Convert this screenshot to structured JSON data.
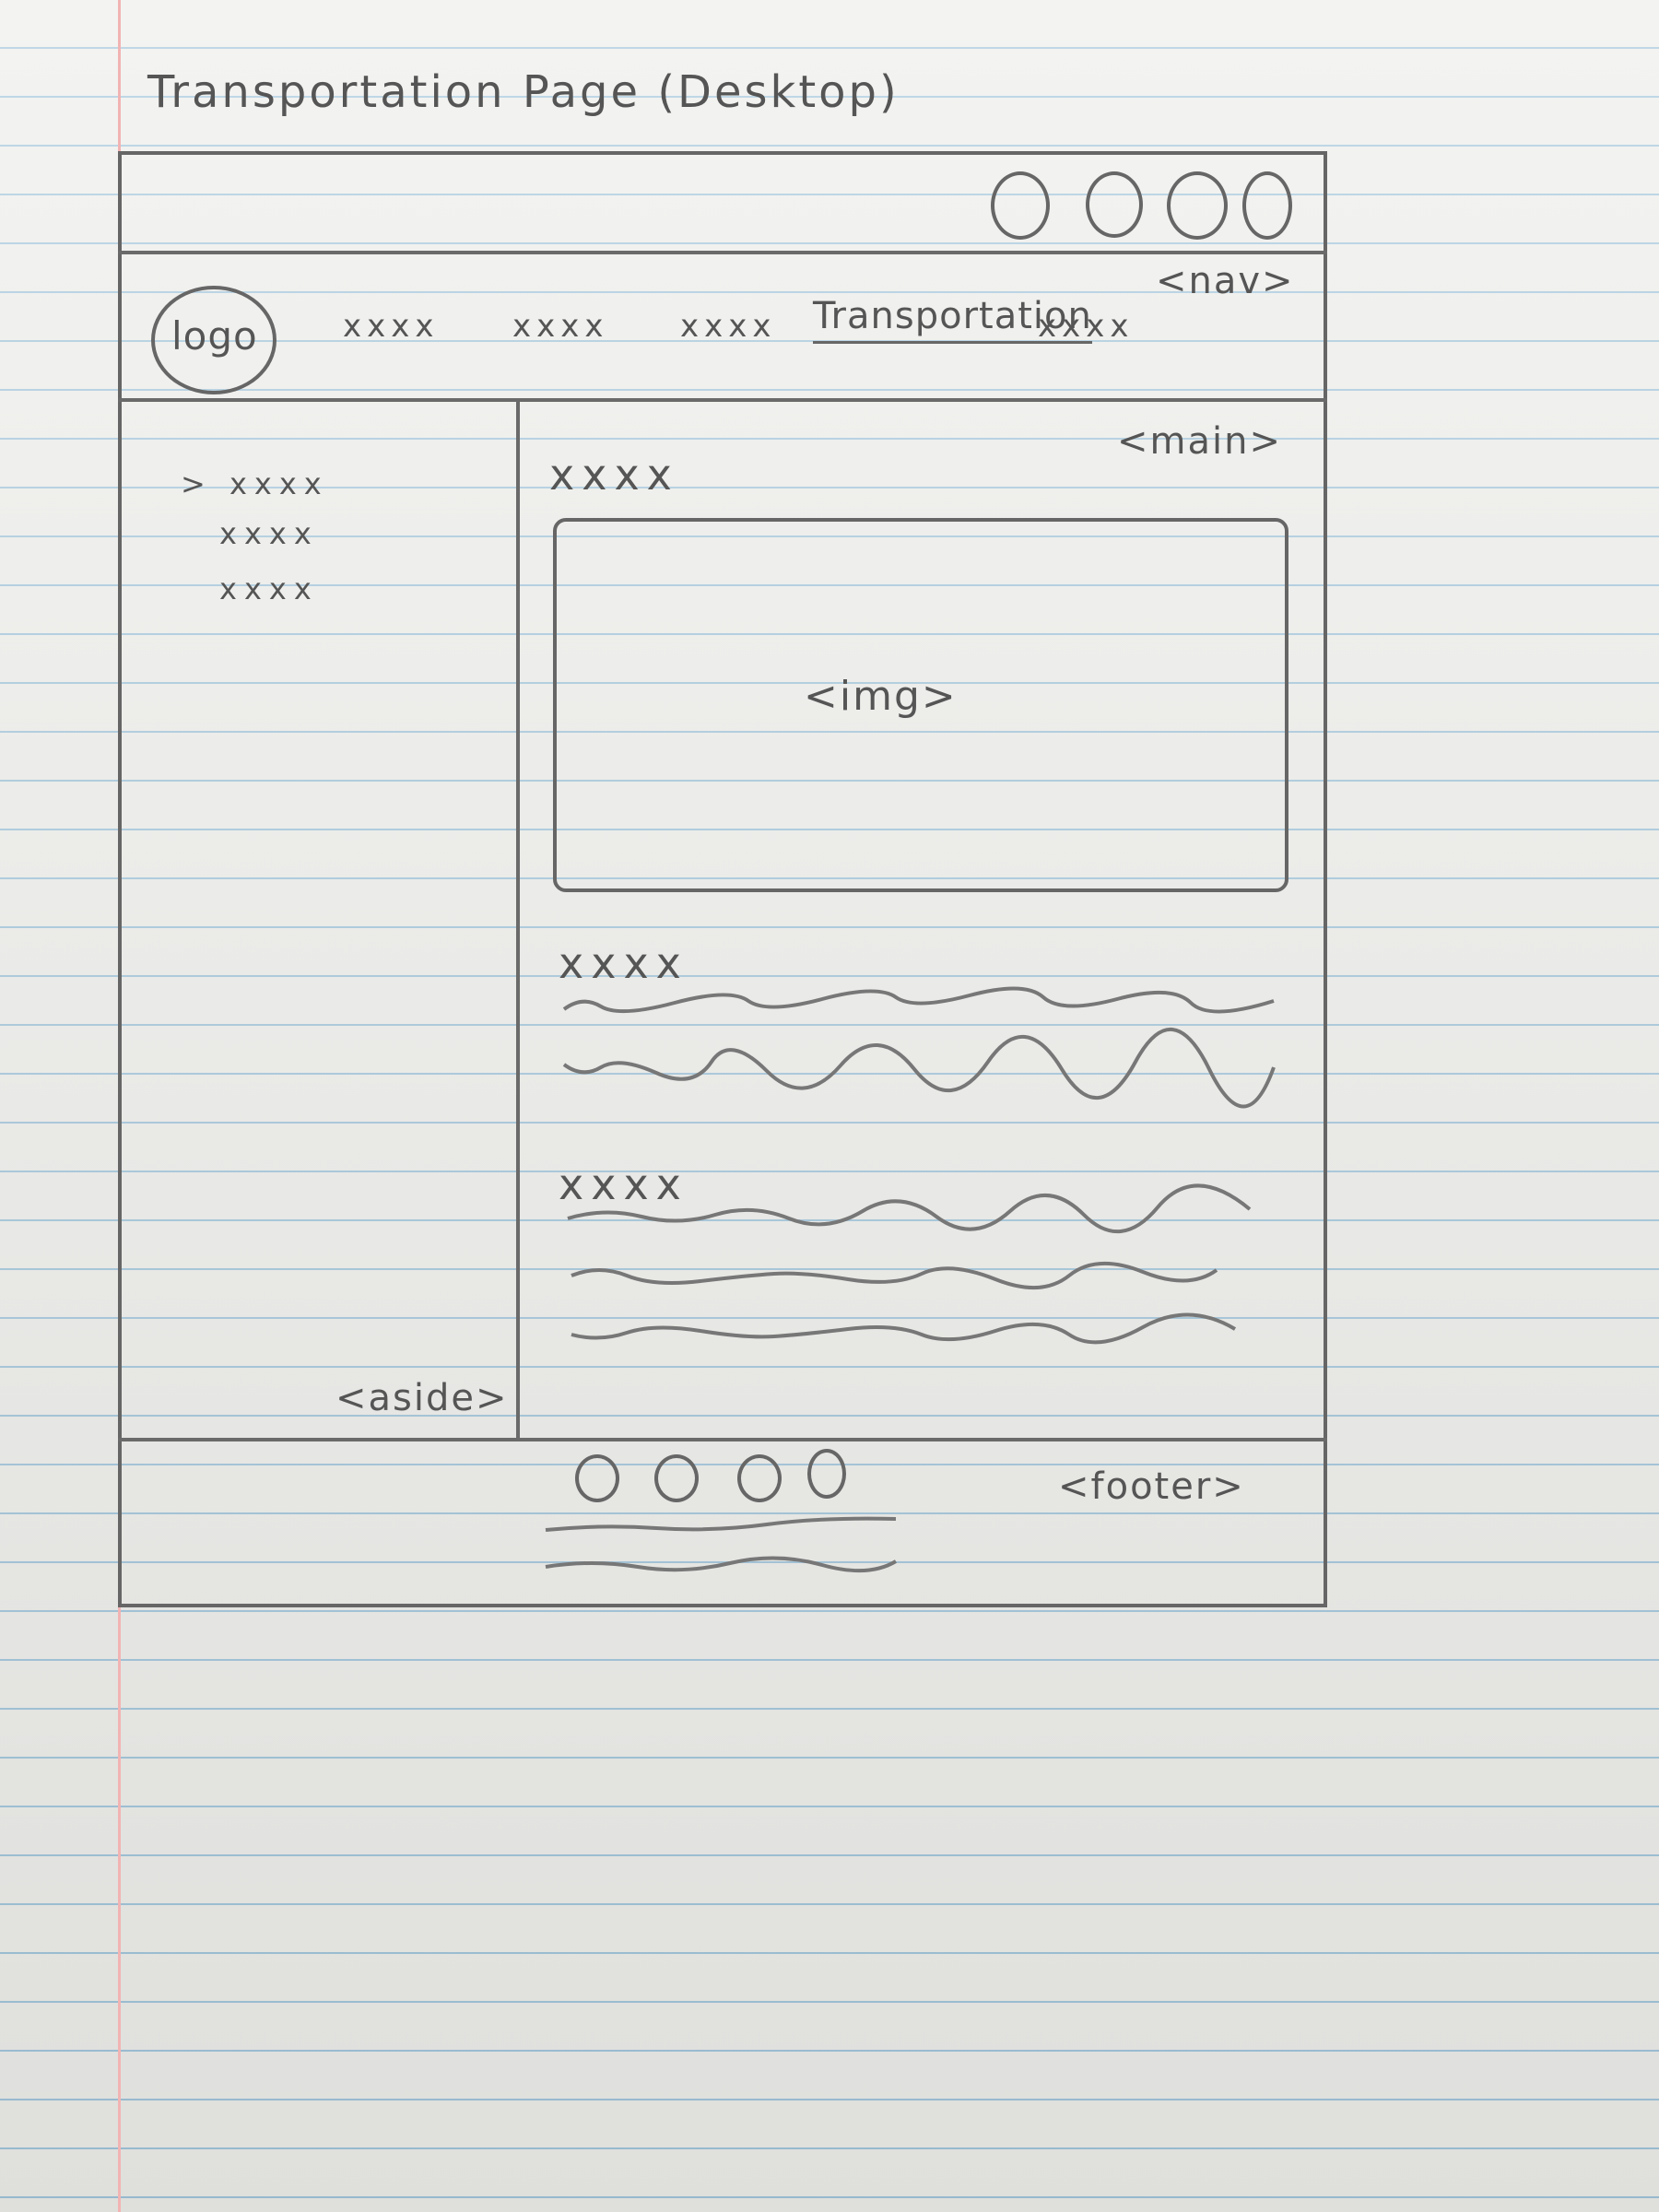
{
  "page_title": "Transportation Page (Desktop)",
  "tags": {
    "nav": "<nav>",
    "main": "<main>",
    "img": "<img>",
    "aside": "<aside>",
    "footer": "<footer>"
  },
  "header": {
    "logo": "logo",
    "nav_items": [
      "xxxx",
      "xxxx",
      "xxxx",
      "Transportation",
      "xxxx"
    ],
    "active_item": "Transportation"
  },
  "aside": {
    "items": [
      "> xxxx",
      "xxxx",
      "xxxx"
    ]
  },
  "main": {
    "title": "xxxx",
    "section_1_heading": "xxxx",
    "section_2_heading": "xxxx"
  },
  "colors": {
    "paper": "#ededea",
    "ruled_line": "#9fc4da",
    "margin_line": "#f2b3b3",
    "pencil": "#666666"
  }
}
